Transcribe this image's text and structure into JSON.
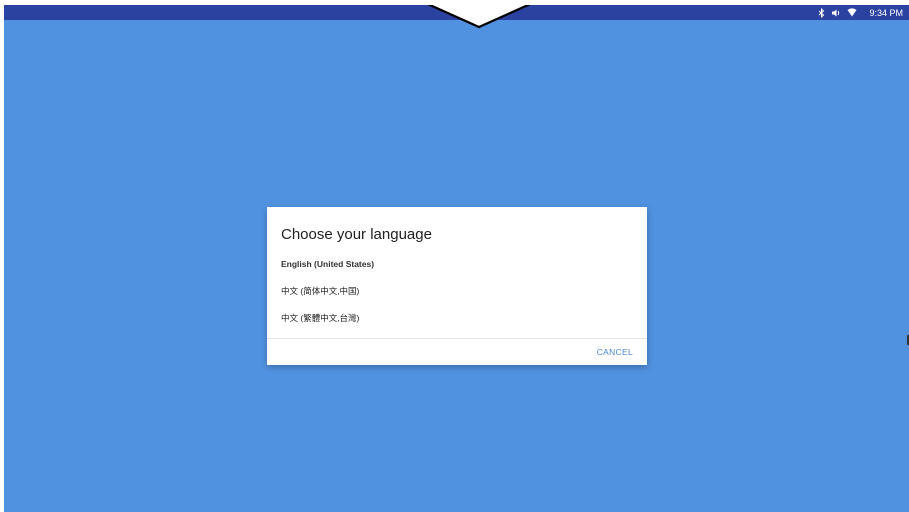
{
  "status_bar": {
    "time": "9:34 PM",
    "icons": [
      "bluetooth-icon",
      "volume-icon",
      "wifi-icon"
    ]
  },
  "dialog": {
    "title": "Choose your language",
    "languages": [
      {
        "label": "English (United States)",
        "selected": true
      },
      {
        "label": "中文 (简体中文,中国)",
        "selected": false
      },
      {
        "label": "中文 (繁體中文,台灣)",
        "selected": false
      }
    ],
    "cancel_label": "CANCEL"
  },
  "colors": {
    "background": "#5091e0",
    "status_bar": "#2c42a0",
    "accent": "#4a86d4",
    "dialog": "#ffffff"
  }
}
